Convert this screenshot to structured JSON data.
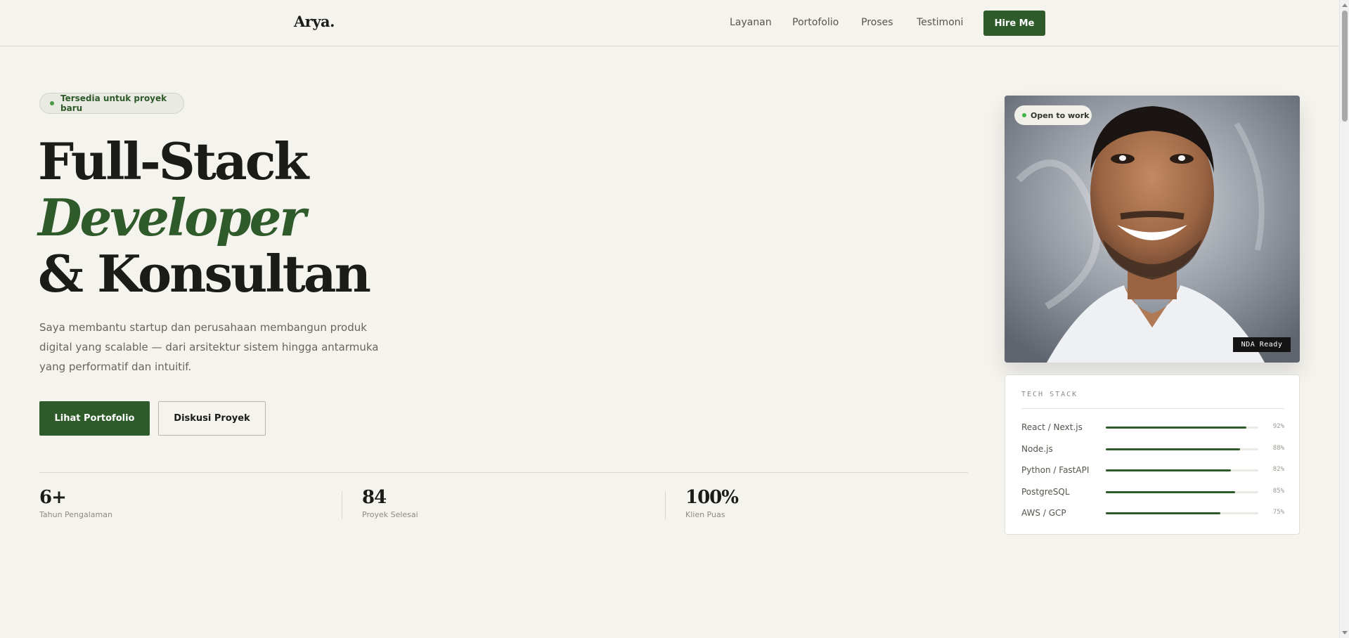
{
  "header": {
    "logo": "Arya.",
    "nav": [
      {
        "label": "Layanan"
      },
      {
        "label": "Portofolio"
      },
      {
        "label": "Proses"
      },
      {
        "label": "Testimoni"
      }
    ],
    "cta": "Hire Me"
  },
  "hero": {
    "badge": "Tersedia untuk proyek baru",
    "title_line1": "Full-Stack",
    "title_line2": "Developer",
    "title_line3": "& Konsultan",
    "description": "Saya membantu startup dan perusahaan membangun produk digital yang scalable — dari arsitektur sistem hingga antarmuka yang performatif dan intuitif.",
    "primary_button": "Lihat Portofolio",
    "secondary_button": "Diskusi Proyek"
  },
  "stats": [
    {
      "value": "6+",
      "label": "Tahun Pengalaman"
    },
    {
      "value": "84",
      "label": "Proyek Selesai"
    },
    {
      "value": "100%",
      "label": "Klien Puas"
    }
  ],
  "profile": {
    "status": "Open to work",
    "nda": "NDA Ready"
  },
  "tech_stack": {
    "title": "TECH STACK",
    "skills": [
      {
        "name": "React / Next.js",
        "level": 92,
        "label": "92%"
      },
      {
        "name": "Node.js",
        "level": 88,
        "label": "88%"
      },
      {
        "name": "Python / FastAPI",
        "level": 82,
        "label": "82%"
      },
      {
        "name": "PostgreSQL",
        "level": 85,
        "label": "85%"
      },
      {
        "name": "AWS / GCP",
        "level": 75,
        "label": "75%"
      }
    ]
  },
  "colors": {
    "accent": "#2f5a2a",
    "background": "#f5f3ee",
    "text": "#1b1b17",
    "status_green": "#3fb54a"
  }
}
